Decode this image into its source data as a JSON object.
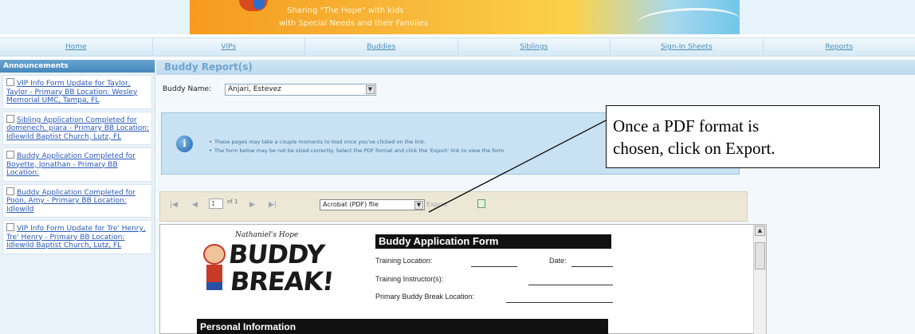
{
  "banner": {
    "tagline_line1": "Sharing \"The Hope\" with kids",
    "tagline_line2": "with Special Needs and their Families"
  },
  "nav": {
    "items": [
      "Home",
      "VIPs",
      "Buddies",
      "Siblings",
      "Sign-In Sheets",
      "Reports"
    ]
  },
  "sidebar": {
    "title": "Announcements",
    "items": [
      {
        "label": "VIP Info Form Update for Taylor, Taylor - Primary BB Location: Wesley Memorial UMC, Tampa, FL"
      },
      {
        "label": "Sibling Application Completed for domenech, piara - Primary BB Location: Idlewild Baptist Church, Lutz, FL"
      },
      {
        "label": "Buddy Application Completed for Boyette, Jonathan - Primary BB Location:"
      },
      {
        "label": "Buddy Application Completed for Poon, Amy - Primary BB Location: Idlewild"
      },
      {
        "label": "VIP Info Form Update for Tre' Henry, Tre' Henry - Primary BB Location: Idlewild Baptist Church, Lutz, FL"
      }
    ]
  },
  "main": {
    "title": "Buddy Report(s)",
    "buddy_name_label": "Buddy Name:",
    "buddy_name_value": "Anjari, Estevez",
    "info_lines": [
      "These pages may take a couple moments to load once you've clicked on the link.",
      "The form below may be not be sized correctly. Select the PDF format and click the 'Export' link to view the form."
    ]
  },
  "viewer": {
    "page_number": "1",
    "page_of": "of 1",
    "format_value": "Acrobat (PDF) file",
    "export_label": "Export",
    "logo_small": "Nathaniel's Hope",
    "logo_word1": "BUDDY",
    "logo_word2": "BREAK!",
    "form_title": "Buddy Application Form",
    "training_location": "Training Location:",
    "date": "Date:",
    "training_instructor": "Training Instructor(s):",
    "primary_location": "Primary Buddy Break Location:",
    "section_personal": "Personal Information"
  },
  "callout": {
    "line1": "Once a PDF format is",
    "line2": "chosen, click on Export."
  }
}
